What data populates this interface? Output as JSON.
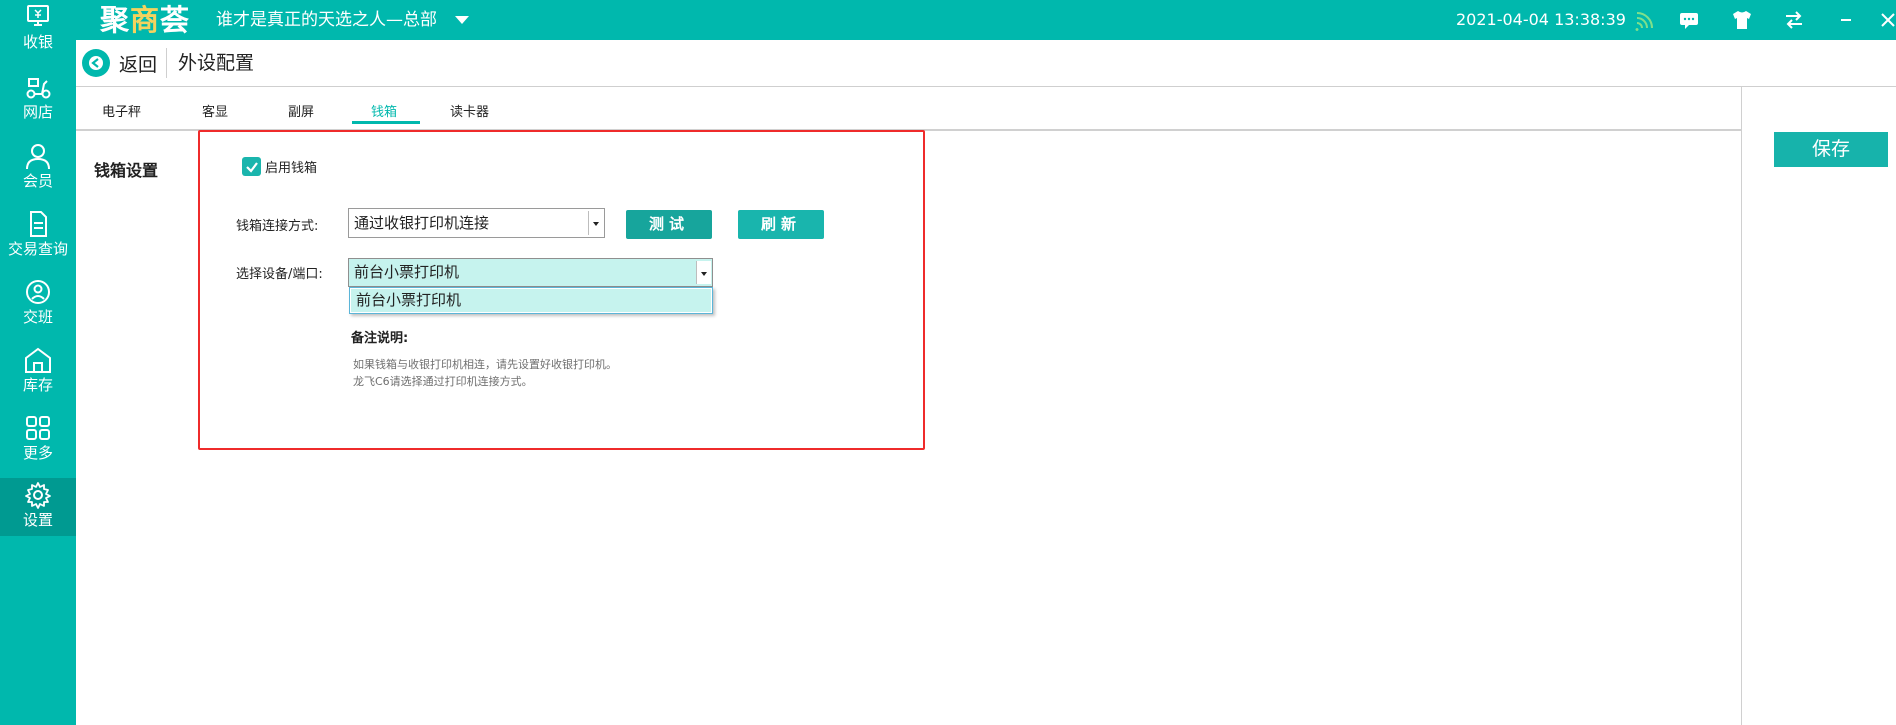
{
  "app": {
    "logo": [
      "聚",
      "商",
      "荟"
    ],
    "store_name": "谁才是真正的天选之人—总部",
    "datetime": "2021-04-04 13:38:39"
  },
  "colors": {
    "primary": "#00b8ad",
    "sidebar_active": "#009a91",
    "highlight": "#c6f3ee",
    "border_alert": "#ef2b2b"
  },
  "topbar_icons": [
    "wifi-icon",
    "message-icon",
    "shirt-icon",
    "swap-icon",
    "minimize-icon",
    "close-icon"
  ],
  "sidebar": {
    "items": [
      {
        "label": "收银",
        "icon": "cashier-monitor-icon"
      },
      {
        "label": "网店",
        "icon": "scooter-icon"
      },
      {
        "label": "会员",
        "icon": "person-icon"
      },
      {
        "label": "交易查询",
        "icon": "document-icon"
      },
      {
        "label": "交班",
        "icon": "handover-user-icon"
      },
      {
        "label": "库存",
        "icon": "warehouse-icon"
      },
      {
        "label": "更多",
        "icon": "grid-icon"
      },
      {
        "label": "设置",
        "icon": "gear-icon",
        "active": true
      }
    ]
  },
  "header": {
    "back_label": "返回",
    "title": "外设配置"
  },
  "tabs": [
    {
      "label": "电子秤"
    },
    {
      "label": "客显"
    },
    {
      "label": "副屏"
    },
    {
      "label": "钱箱",
      "active": true
    },
    {
      "label": "读卡器"
    }
  ],
  "save_label": "保存",
  "cashbox": {
    "section_title": "钱箱设置",
    "enable_label": "启用钱箱",
    "enabled": true,
    "connect_label": "钱箱连接方式:",
    "connect_value": "通过收银打印机连接",
    "test_label": "测试",
    "refresh_label": "刷新",
    "device_label": "选择设备/端口:",
    "device_value": "前台小票打印机",
    "device_options": [
      "前台小票打印机"
    ],
    "remark_title": "备注说明:",
    "remarks": [
      "如果钱箱与收银打印机相连，请先设置好收银打印机。",
      "龙飞C6请选择通过打印机连接方式。"
    ]
  }
}
